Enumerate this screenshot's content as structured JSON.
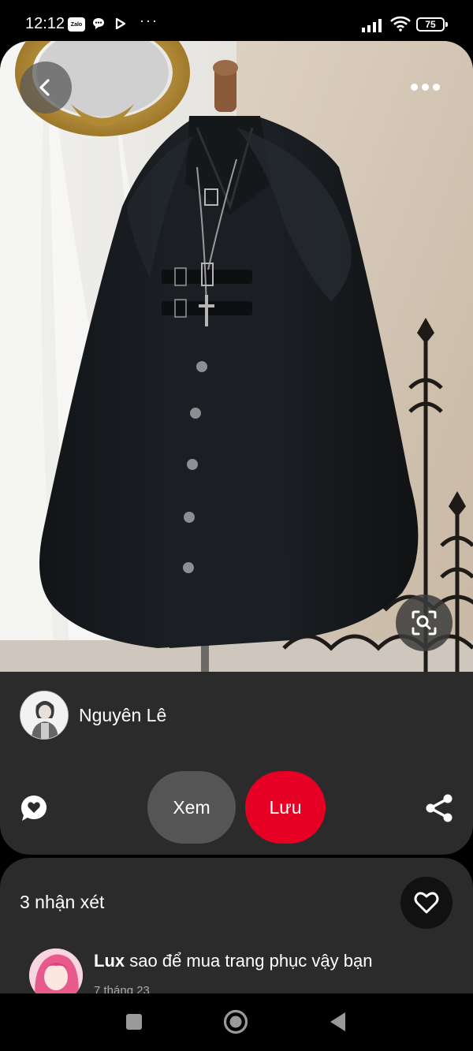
{
  "status_bar": {
    "time": "12:12",
    "zalo_label": "Zalo",
    "more": "···",
    "battery": "75",
    "icons": [
      "zalo-icon",
      "chat-bubble-icon",
      "play-icon",
      "signal-icon",
      "wifi-icon",
      "battery-icon"
    ]
  },
  "pin": {
    "author": "Nguyên Lê",
    "view_label": "Xem",
    "save_label": "Lưu",
    "save_color": "#e60023"
  },
  "comments": {
    "count_label": "3 nhận xét",
    "items": [
      {
        "user": "Lux",
        "text": "sao để mua trang phục vậy bạn",
        "meta": "7 tháng 23"
      }
    ]
  },
  "nav": {
    "icons": [
      "recents-icon",
      "home-icon",
      "back-icon"
    ]
  }
}
